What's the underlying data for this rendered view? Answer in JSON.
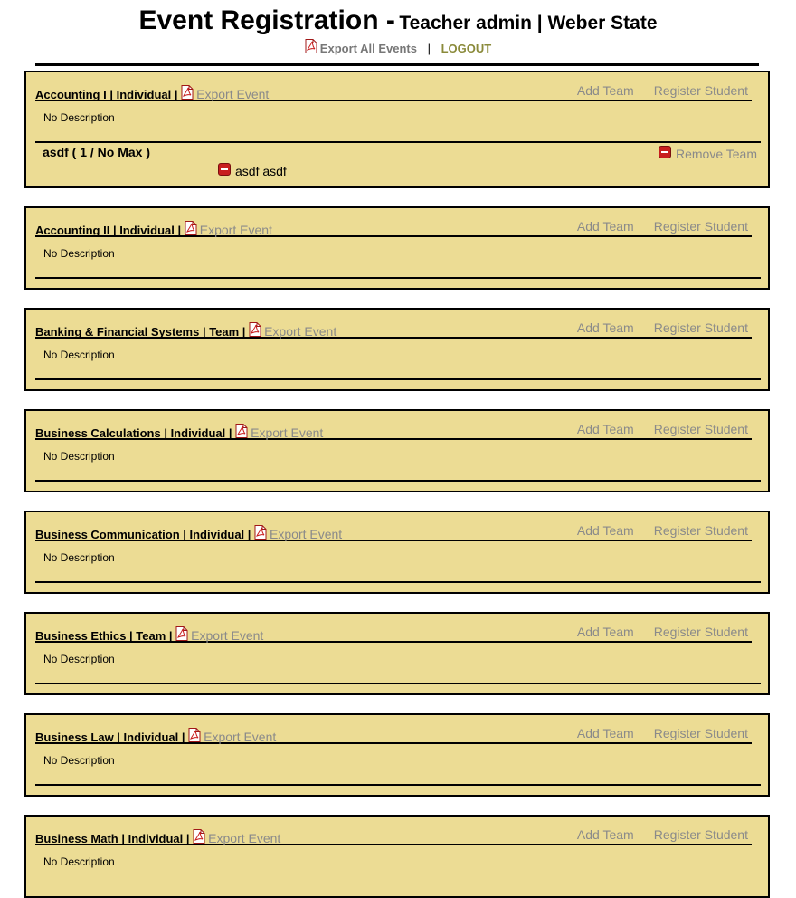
{
  "header": {
    "title": "Event Registration -",
    "subtitle": "Teacher admin | Weber State",
    "export_all_label": "Export All Events",
    "separator": "|",
    "logout_label": "LOGOUT"
  },
  "actions": {
    "export_event_label": "Export Event",
    "add_team_label": "Add Team",
    "register_student_label": "Register Student",
    "remove_team_label": "Remove Team"
  },
  "icons": {
    "pdf": "pdf-icon",
    "remove": "minus-circle-icon"
  },
  "colors": {
    "panel_bg": "#ecdc94",
    "link_gray": "#8a8a8a",
    "logout": "#8a8a3a",
    "remove_red": "#c81e1e"
  },
  "events": [
    {
      "title": "Accounting I | Individual |",
      "description": "No Description",
      "teams": [
        {
          "name": "asdf ( 1 / No Max )",
          "students": [
            "asdf asdf"
          ]
        }
      ]
    },
    {
      "title": "Accounting II | Individual |",
      "description": "No Description",
      "teams": []
    },
    {
      "title": "Banking & Financial Systems | Team |",
      "description": "No Description",
      "teams": []
    },
    {
      "title": "Business Calculations | Individual |",
      "description": "No Description",
      "teams": []
    },
    {
      "title": "Business Communication | Individual |",
      "description": "No Description",
      "teams": []
    },
    {
      "title": "Business Ethics | Team |",
      "description": "No Description",
      "teams": []
    },
    {
      "title": "Business Law | Individual |",
      "description": "No Description",
      "teams": []
    },
    {
      "title": "Business Math | Individual |",
      "description": "No Description",
      "teams": []
    }
  ]
}
